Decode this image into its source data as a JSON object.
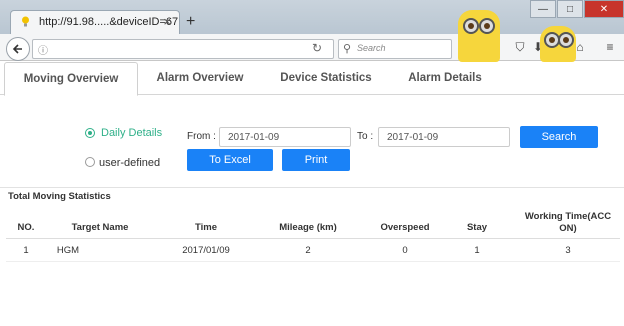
{
  "browser": {
    "tab_title": "http://91.98.....&deviceID=67",
    "tab_close": "×",
    "new_tab": "+",
    "url": "",
    "search_placeholder": "Search",
    "window_controls": {
      "minimize": "—",
      "maximize": "□",
      "close": "✕"
    }
  },
  "tabs": [
    {
      "label": "Moving Overview",
      "active": true
    },
    {
      "label": "Alarm Overview",
      "active": false
    },
    {
      "label": "Device Statistics",
      "active": false
    },
    {
      "label": "Alarm Details",
      "active": false
    }
  ],
  "filters": {
    "options": [
      {
        "label": "Daily Details",
        "checked": true
      },
      {
        "label": "user-defined",
        "checked": false
      }
    ],
    "from_label": "From :",
    "from_value": "2017-01-09",
    "to_label": "To :",
    "to_value": "2017-01-09",
    "search_button": "Search",
    "excel_button": "To Excel",
    "print_button": "Print"
  },
  "table": {
    "section_title": "Total Moving Statistics",
    "columns": [
      "NO.",
      "Target Name",
      "Time",
      "Mileage (km)",
      "Overspeed",
      "Stay",
      "Working Time(ACC ON)"
    ],
    "rows": [
      [
        "1",
        "HGM",
        "2017/01/09",
        "2",
        "0",
        "1",
        "3"
      ]
    ]
  },
  "colors": {
    "accent_blue": "#1a82f7",
    "radio_green": "#2fb089"
  }
}
